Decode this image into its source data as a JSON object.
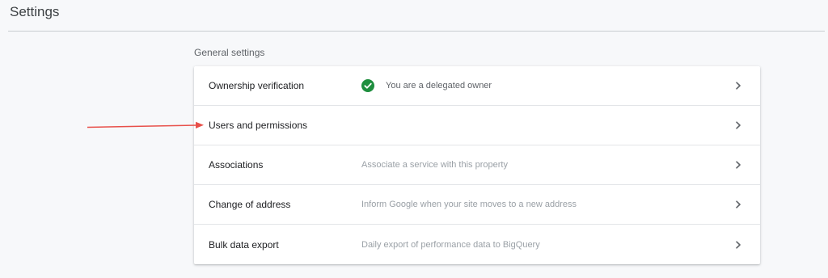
{
  "header": {
    "title": "Settings"
  },
  "section": {
    "title": "General settings"
  },
  "rows": [
    {
      "label": "Ownership verification",
      "status": "You are a delegated owner",
      "status_icon": "check-circle-icon",
      "status_color": "#1e8e3e"
    },
    {
      "label": "Users and permissions",
      "description": ""
    },
    {
      "label": "Associations",
      "description": "Associate a service with this property"
    },
    {
      "label": "Change of address",
      "description": "Inform Google when your site moves to a new address"
    },
    {
      "label": "Bulk data export",
      "description": "Daily export of performance data to BigQuery"
    }
  ],
  "annotation": {
    "arrow_color": "#e8504a",
    "points_to": "Users and permissions"
  }
}
